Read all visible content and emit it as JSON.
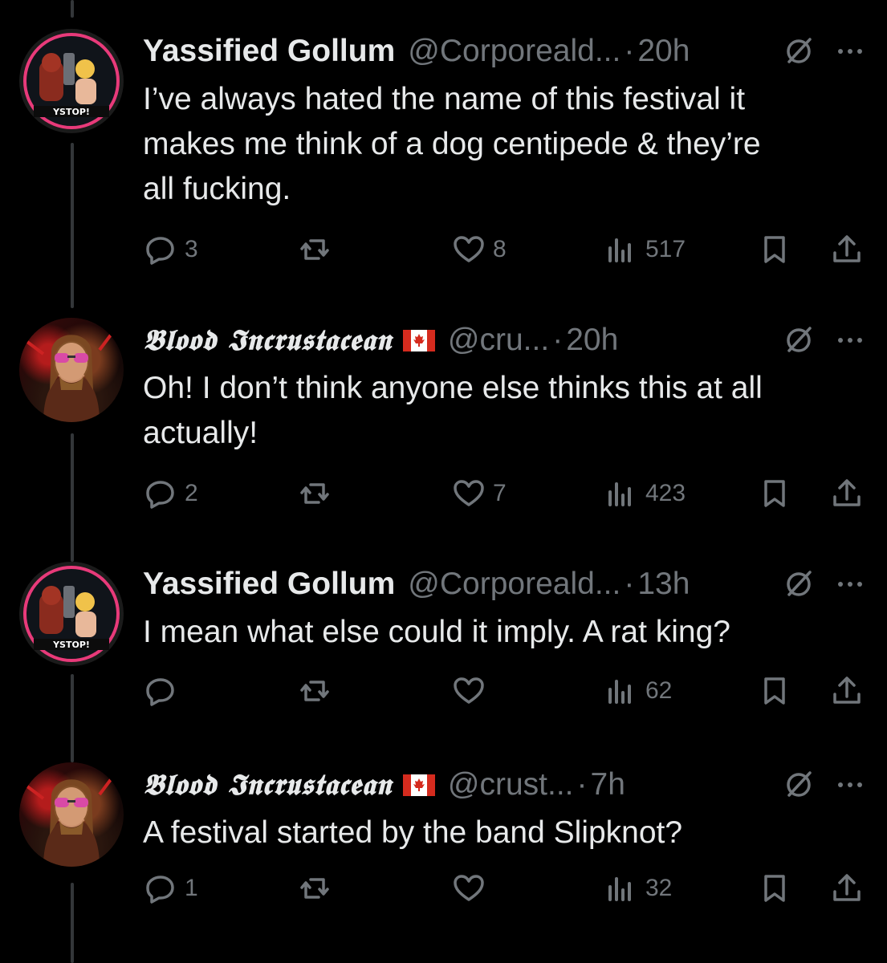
{
  "tweets": [
    {
      "name": "Yassified Gollum",
      "handle": "@Corporeald...",
      "separator": "·",
      "time": "20h",
      "text": "I’ve always hated the name of this festival it\nmakes me think of a dog centipede & they’re\nall fucking.",
      "stats": {
        "replies": "3",
        "retweets": "",
        "likes": "8",
        "views": "517"
      },
      "has_flag": false
    },
    {
      "name": "𝕭𝖑𝖔𝖔𝖉 𝕴𝖓𝖈𝖗𝖚𝖘𝖙𝖆𝖈𝖊𝖆𝖓",
      "handle": "@cru...",
      "separator": "·",
      "time": "20h",
      "text": "Oh! I don’t think anyone else thinks this at all\nactually!",
      "stats": {
        "replies": "2",
        "retweets": "",
        "likes": "7",
        "views": "423"
      },
      "has_flag": true
    },
    {
      "name": "Yassified Gollum",
      "handle": "@Corporeald...",
      "separator": "·",
      "time": "13h",
      "text": "I mean what else could it imply. A rat king?",
      "stats": {
        "replies": "",
        "retweets": "",
        "likes": "",
        "views": "62"
      },
      "has_flag": false
    },
    {
      "name": "𝕭𝖑𝖔𝖔𝖉 𝕴𝖓𝖈𝖗𝖚𝖘𝖙𝖆𝖈𝖊𝖆𝖓",
      "handle": "@crust...",
      "separator": "·",
      "time": "7h",
      "text": "A festival started by the band Slipknot?",
      "stats": {
        "replies": "1",
        "retweets": "",
        "likes": "",
        "views": "32"
      },
      "has_flag": true
    }
  ],
  "icons": {
    "reply": "reply-icon",
    "retweet": "retweet-icon",
    "like": "like-icon",
    "views": "views-icon",
    "bookmark": "bookmark-icon",
    "share": "share-icon",
    "grok": "grok-icon",
    "more": "more-icon",
    "flag": "canada-flag-icon"
  },
  "colors": {
    "background": "#000000",
    "text": "#e7e9ea",
    "muted": "#71767b",
    "thread_line": "#333639"
  }
}
